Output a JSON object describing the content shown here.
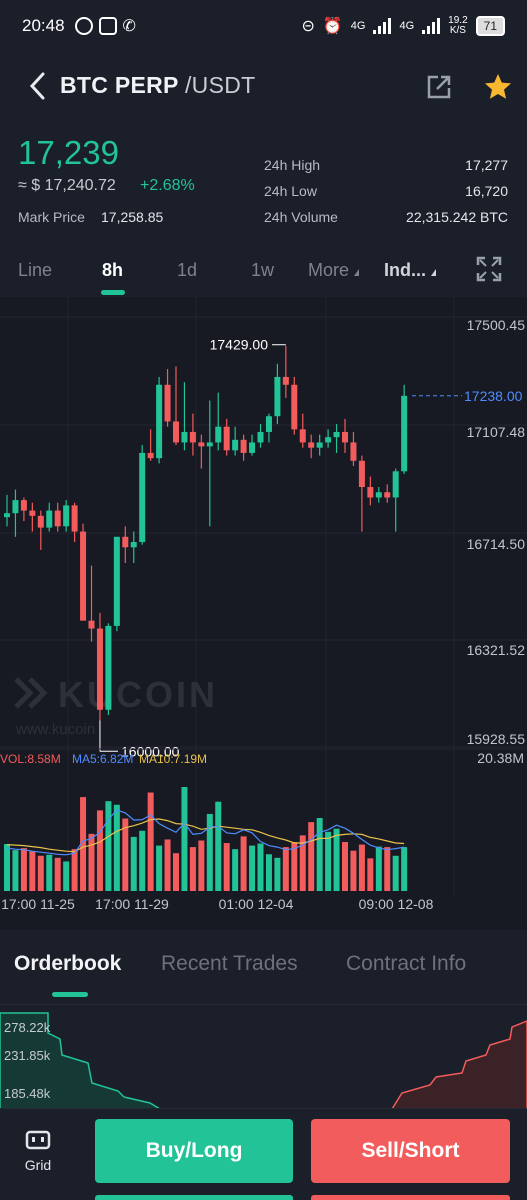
{
  "status_bar": {
    "time": "20:48",
    "net_top": "4G",
    "net_speed": "19.2",
    "net_speed_unit": "K/S",
    "battery": "71"
  },
  "header": {
    "base": "BTC PERP",
    "quote": "/USDT"
  },
  "ticker": {
    "last_price": "17,239",
    "approx_usd": "≈ $ 17,240.72",
    "change_pct": "+2.68%",
    "mark_price_label": "Mark Price",
    "mark_price": "17,258.85",
    "high_label": "24h High",
    "high": "17,277",
    "low_label": "24h Low",
    "low": "16,720",
    "volume_label": "24h Volume",
    "volume": "22,315.242 BTC"
  },
  "timeframes": {
    "items": [
      "Line",
      "8h",
      "1d",
      "1w",
      "More",
      "Ind..."
    ],
    "active": "8h"
  },
  "colors": {
    "up": "#21c397",
    "down": "#f25c5c",
    "ma5": "#4f8cff",
    "ma10": "#e8c24a",
    "bg": "#1b1f2a",
    "chart_bg": "#171a22"
  },
  "chart_data": {
    "type": "candlestick",
    "price_axis_labels": [
      "17500.45",
      "17107.48",
      "16714.50",
      "16321.52",
      "15928.55"
    ],
    "ylim": [
      15928.55,
      17500.45
    ],
    "current_price_label": "17238.00",
    "current_price": 17238.0,
    "max_annotation": "17429.00",
    "min_annotation": "16000.00",
    "x_labels": [
      "17:00 11-25",
      "17:00 11-29",
      "01:00 12-04",
      "09:00 12-08"
    ],
    "watermark": "KUCOIN",
    "watermark_url": "www.kucoin",
    "volume_label": "VOL:8.58M",
    "ma5_label": "MA5:6.82M",
    "ma10_label": "MA10:7.19M",
    "volume_axis_label": "20.38M",
    "candles": [
      {
        "o": 16775,
        "h": 16860,
        "l": 16740,
        "c": 16790
      },
      {
        "o": 16790,
        "h": 16880,
        "l": 16700,
        "c": 16840
      },
      {
        "o": 16840,
        "h": 16850,
        "l": 16760,
        "c": 16800
      },
      {
        "o": 16800,
        "h": 16830,
        "l": 16720,
        "c": 16780
      },
      {
        "o": 16780,
        "h": 16800,
        "l": 16650,
        "c": 16735
      },
      {
        "o": 16735,
        "h": 16830,
        "l": 16720,
        "c": 16800
      },
      {
        "o": 16800,
        "h": 16830,
        "l": 16720,
        "c": 16740
      },
      {
        "o": 16740,
        "h": 16840,
        "l": 16720,
        "c": 16820
      },
      {
        "o": 16820,
        "h": 16830,
        "l": 16680,
        "c": 16720
      },
      {
        "o": 16720,
        "h": 16750,
        "l": 16440,
        "c": 16380
      },
      {
        "o": 16380,
        "h": 16590,
        "l": 16300,
        "c": 16350
      },
      {
        "o": 16350,
        "h": 16410,
        "l": 16000,
        "c": 16040
      },
      {
        "o": 16040,
        "h": 16370,
        "l": 16020,
        "c": 16360
      },
      {
        "o": 16360,
        "h": 16700,
        "l": 16340,
        "c": 16700
      },
      {
        "o": 16700,
        "h": 16740,
        "l": 16600,
        "c": 16660
      },
      {
        "o": 16660,
        "h": 16720,
        "l": 16600,
        "c": 16680
      },
      {
        "o": 16680,
        "h": 17050,
        "l": 16670,
        "c": 17020
      },
      {
        "o": 17020,
        "h": 17110,
        "l": 16990,
        "c": 17000
      },
      {
        "o": 17000,
        "h": 17310,
        "l": 16980,
        "c": 17280
      },
      {
        "o": 17280,
        "h": 17340,
        "l": 17120,
        "c": 17140
      },
      {
        "o": 17140,
        "h": 17350,
        "l": 17050,
        "c": 17060
      },
      {
        "o": 17060,
        "h": 17290,
        "l": 17030,
        "c": 17100
      },
      {
        "o": 17100,
        "h": 17170,
        "l": 17010,
        "c": 17060
      },
      {
        "o": 17060,
        "h": 17090,
        "l": 16960,
        "c": 17045
      },
      {
        "o": 17045,
        "h": 17220,
        "l": 16740,
        "c": 17060
      },
      {
        "o": 17060,
        "h": 17250,
        "l": 17030,
        "c": 17120
      },
      {
        "o": 17120,
        "h": 17150,
        "l": 17010,
        "c": 17030
      },
      {
        "o": 17030,
        "h": 17120,
        "l": 17010,
        "c": 17070
      },
      {
        "o": 17070,
        "h": 17090,
        "l": 16990,
        "c": 17020
      },
      {
        "o": 17020,
        "h": 17090,
        "l": 17010,
        "c": 17060
      },
      {
        "o": 17060,
        "h": 17130,
        "l": 17040,
        "c": 17100
      },
      {
        "o": 17100,
        "h": 17170,
        "l": 17060,
        "c": 17160
      },
      {
        "o": 17160,
        "h": 17360,
        "l": 17130,
        "c": 17310
      },
      {
        "o": 17310,
        "h": 17429,
        "l": 17230,
        "c": 17280
      },
      {
        "o": 17280,
        "h": 17310,
        "l": 17090,
        "c": 17110
      },
      {
        "o": 17110,
        "h": 17170,
        "l": 17040,
        "c": 17060
      },
      {
        "o": 17060,
        "h": 17090,
        "l": 17000,
        "c": 17040
      },
      {
        "o": 17040,
        "h": 17090,
        "l": 17010,
        "c": 17060
      },
      {
        "o": 17060,
        "h": 17110,
        "l": 17040,
        "c": 17080
      },
      {
        "o": 17080,
        "h": 17130,
        "l": 17020,
        "c": 17100
      },
      {
        "o": 17100,
        "h": 17150,
        "l": 17020,
        "c": 17060
      },
      {
        "o": 17060,
        "h": 17100,
        "l": 16970,
        "c": 16990
      },
      {
        "o": 16990,
        "h": 17010,
        "l": 16720,
        "c": 16890
      },
      {
        "o": 16890,
        "h": 16930,
        "l": 16820,
        "c": 16850
      },
      {
        "o": 16850,
        "h": 16890,
        "l": 16830,
        "c": 16870
      },
      {
        "o": 16870,
        "h": 16900,
        "l": 16830,
        "c": 16850
      },
      {
        "o": 16850,
        "h": 16960,
        "l": 16720,
        "c": 16950
      },
      {
        "o": 16950,
        "h": 17280,
        "l": 16940,
        "c": 17238
      }
    ],
    "volumes": [
      9.2,
      8.0,
      8.4,
      7.8,
      6.9,
      7.1,
      6.5,
      5.8,
      8.2,
      18.4,
      11.2,
      15.8,
      17.6,
      16.9,
      14.2,
      10.6,
      11.8,
      19.3,
      8.9,
      10.1,
      7.4,
      20.38,
      8.6,
      9.9,
      15.1,
      17.5,
      9.4,
      8.2,
      10.7,
      8.9,
      9.3,
      7.2,
      6.5,
      8.6,
      9.6,
      10.9,
      13.5,
      14.3,
      11.6,
      12.2,
      9.6,
      7.9,
      9.1,
      6.4,
      8.7,
      8.6,
      6.9,
      8.6
    ],
    "ma5": [
      8.4,
      8.2,
      8.1,
      7.8,
      7.6,
      7.4,
      7.2,
      7.1,
      7.4,
      9.8,
      10.3,
      11.5,
      14.0,
      15.9,
      15.3,
      13.9,
      14.0,
      14.9,
      13.2,
      12.3,
      11.5,
      13.3,
      11.1,
      11.3,
      12.5,
      12.7,
      11.4,
      11.2,
      12.0,
      11.4,
      9.7,
      8.9,
      8.6,
      8.1,
      8.3,
      9.0,
      10.1,
      11.5,
      12.0,
      12.9,
      12.3,
      11.3,
      10.1,
      9.0,
      8.4,
      8.1,
      8.3,
      8.6
    ],
    "ma10": [
      9.1,
      9.0,
      8.9,
      8.7,
      8.5,
      8.2,
      8.0,
      7.8,
      7.7,
      8.6,
      9.0,
      9.6,
      10.7,
      11.7,
      12.4,
      12.8,
      13.3,
      14.0,
      14.1,
      13.8,
      13.2,
      13.1,
      12.7,
      12.1,
      12.3,
      12.7,
      12.5,
      12.3,
      12.1,
      12.0,
      11.5,
      10.9,
      10.4,
      10.0,
      9.4,
      9.4,
      9.8,
      10.3,
      10.3,
      10.9,
      11.1,
      11.2,
      11.1,
      10.5,
      10.2,
      9.8,
      9.4,
      9.3
    ]
  },
  "orderbook": {
    "tabs": [
      "Orderbook",
      "Recent Trades",
      "Contract Info"
    ],
    "active": "Orderbook",
    "depth_labels": [
      "278.22k",
      "231.85k",
      "185.48k"
    ]
  },
  "bottom": {
    "grid_label": "Grid",
    "buy_label": "Buy/Long",
    "sell_label": "Sell/Short"
  }
}
